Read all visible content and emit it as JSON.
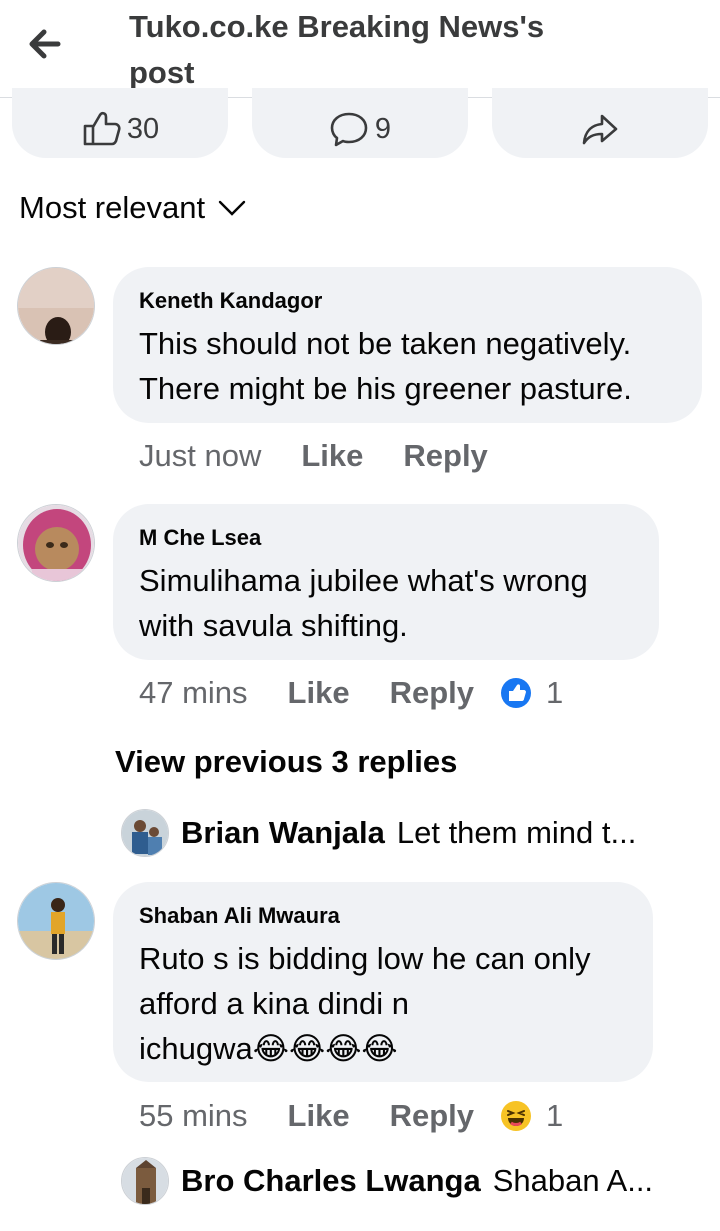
{
  "header": {
    "title_line1": "Tuko.co.ke Breaking News's",
    "title_line2": "post"
  },
  "actions": {
    "like_count": "30",
    "comment_count": "9"
  },
  "sort": {
    "label": "Most relevant"
  },
  "comments": [
    {
      "author": "Keneth Kandagor",
      "text_line1": "This should not be taken negatively.",
      "text_line2": "There might be his greener pasture.",
      "time": "Just now",
      "like_label": "Like",
      "reply_label": "Reply"
    },
    {
      "author": "M Che Lsea",
      "text_line1": "Simulihama jubilee what's wrong",
      "text_line2": "with savula shifting.",
      "time": "47 mins",
      "like_label": "Like",
      "reply_label": "Reply",
      "reaction_count": "1"
    },
    {
      "author": "Shaban Ali Mwaura",
      "text_line1": "Ruto s is bidding low he can only",
      "text_line2": "afford a kina dindi n",
      "text_line3": "ichugwa",
      "emojis": "😂😂😂😂",
      "time": "55 mins",
      "like_label": "Like",
      "reply_label": "Reply",
      "reaction_count": "1"
    }
  ],
  "view_previous": "View previous 3 replies",
  "replies": [
    {
      "author": "Brian Wanjala",
      "preview": "Let them mind t..."
    },
    {
      "author": "Bro Charles Lwanga",
      "preview": "Shaban A..."
    }
  ]
}
